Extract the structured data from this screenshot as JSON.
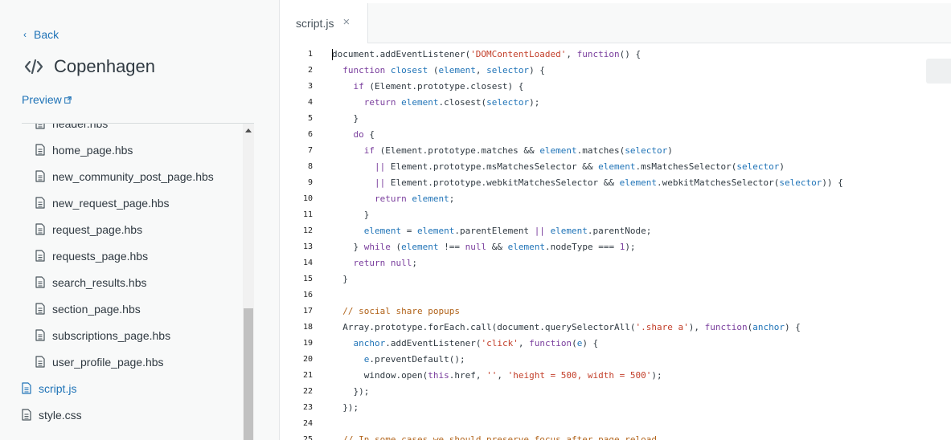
{
  "sidebar": {
    "back_label": "Back",
    "theme_name": "Copenhagen",
    "preview_label": "Preview",
    "files": [
      {
        "name": "header.hbs",
        "level": "sub",
        "active": false
      },
      {
        "name": "home_page.hbs",
        "level": "sub",
        "active": false
      },
      {
        "name": "new_community_post_page.hbs",
        "level": "sub",
        "active": false
      },
      {
        "name": "new_request_page.hbs",
        "level": "sub",
        "active": false
      },
      {
        "name": "request_page.hbs",
        "level": "sub",
        "active": false
      },
      {
        "name": "requests_page.hbs",
        "level": "sub",
        "active": false
      },
      {
        "name": "search_results.hbs",
        "level": "sub",
        "active": false
      },
      {
        "name": "section_page.hbs",
        "level": "sub",
        "active": false
      },
      {
        "name": "subscriptions_page.hbs",
        "level": "sub",
        "active": false
      },
      {
        "name": "user_profile_page.hbs",
        "level": "sub",
        "active": false
      },
      {
        "name": "script.js",
        "level": "root",
        "active": true
      },
      {
        "name": "style.css",
        "level": "root",
        "active": false
      }
    ]
  },
  "editor": {
    "tab_label": "script.js",
    "tab_close": "×",
    "lines": [
      {
        "n": "1",
        "tokens": [
          [
            "p",
            "document.addEventListener("
          ],
          [
            "s",
            "'DOMContentLoaded'"
          ],
          [
            "p",
            ", "
          ],
          [
            "k",
            "function"
          ],
          [
            "p",
            "() {"
          ]
        ]
      },
      {
        "n": "2",
        "tokens": [
          [
            "p",
            "  "
          ],
          [
            "k",
            "function"
          ],
          [
            "p",
            " "
          ],
          [
            "v",
            "closest"
          ],
          [
            "p",
            " ("
          ],
          [
            "v",
            "element"
          ],
          [
            "p",
            ", "
          ],
          [
            "v",
            "selector"
          ],
          [
            "p",
            ") {"
          ]
        ]
      },
      {
        "n": "3",
        "tokens": [
          [
            "p",
            "    "
          ],
          [
            "k",
            "if"
          ],
          [
            "p",
            " (Element.prototype.closest) {"
          ]
        ]
      },
      {
        "n": "4",
        "tokens": [
          [
            "p",
            "      "
          ],
          [
            "k",
            "return"
          ],
          [
            "p",
            " "
          ],
          [
            "v",
            "element"
          ],
          [
            "p",
            ".closest("
          ],
          [
            "v",
            "selector"
          ],
          [
            "p",
            ");"
          ]
        ]
      },
      {
        "n": "5",
        "tokens": [
          [
            "p",
            "    }"
          ]
        ]
      },
      {
        "n": "6",
        "tokens": [
          [
            "p",
            "    "
          ],
          [
            "k",
            "do"
          ],
          [
            "p",
            " {"
          ]
        ]
      },
      {
        "n": "7",
        "tokens": [
          [
            "p",
            "      "
          ],
          [
            "k",
            "if"
          ],
          [
            "p",
            " (Element.prototype.matches && "
          ],
          [
            "v",
            "element"
          ],
          [
            "p",
            ".matches("
          ],
          [
            "v",
            "selector"
          ],
          [
            "p",
            ")"
          ]
        ]
      },
      {
        "n": "8",
        "tokens": [
          [
            "p",
            "        "
          ],
          [
            "k",
            "||"
          ],
          [
            "p",
            " Element.prototype.msMatchesSelector && "
          ],
          [
            "v",
            "element"
          ],
          [
            "p",
            ".msMatchesSelector("
          ],
          [
            "v",
            "selector"
          ],
          [
            "p",
            ")"
          ]
        ]
      },
      {
        "n": "9",
        "tokens": [
          [
            "p",
            "        "
          ],
          [
            "k",
            "||"
          ],
          [
            "p",
            " Element.prototype.webkitMatchesSelector && "
          ],
          [
            "v",
            "element"
          ],
          [
            "p",
            ".webkitMatchesSelector("
          ],
          [
            "v",
            "selector"
          ],
          [
            "p",
            ")) {"
          ]
        ]
      },
      {
        "n": "10",
        "tokens": [
          [
            "p",
            "        "
          ],
          [
            "k",
            "return"
          ],
          [
            "p",
            " "
          ],
          [
            "v",
            "element"
          ],
          [
            "p",
            ";"
          ]
        ]
      },
      {
        "n": "11",
        "tokens": [
          [
            "p",
            "      }"
          ]
        ]
      },
      {
        "n": "12",
        "tokens": [
          [
            "p",
            "      "
          ],
          [
            "v",
            "element"
          ],
          [
            "p",
            " = "
          ],
          [
            "v",
            "element"
          ],
          [
            "p",
            ".parentElement "
          ],
          [
            "k",
            "||"
          ],
          [
            "p",
            " "
          ],
          [
            "v",
            "element"
          ],
          [
            "p",
            ".parentNode;"
          ]
        ]
      },
      {
        "n": "13",
        "tokens": [
          [
            "p",
            "    } "
          ],
          [
            "k",
            "while"
          ],
          [
            "p",
            " ("
          ],
          [
            "v",
            "element"
          ],
          [
            "p",
            " !== "
          ],
          [
            "k",
            "null"
          ],
          [
            "p",
            " && "
          ],
          [
            "v",
            "element"
          ],
          [
            "p",
            ".nodeType === "
          ],
          [
            "n",
            "1"
          ],
          [
            "p",
            ");"
          ]
        ]
      },
      {
        "n": "14",
        "tokens": [
          [
            "p",
            "    "
          ],
          [
            "k",
            "return"
          ],
          [
            "p",
            " "
          ],
          [
            "k",
            "null"
          ],
          [
            "p",
            ";"
          ]
        ]
      },
      {
        "n": "15",
        "tokens": [
          [
            "p",
            "  }"
          ]
        ]
      },
      {
        "n": "16",
        "tokens": []
      },
      {
        "n": "17",
        "tokens": [
          [
            "p",
            "  "
          ],
          [
            "c",
            "// social share popups"
          ]
        ]
      },
      {
        "n": "18",
        "tokens": [
          [
            "p",
            "  Array.prototype.forEach.call(document.querySelectorAll("
          ],
          [
            "s",
            "'.share a'"
          ],
          [
            "p",
            "), "
          ],
          [
            "k",
            "function"
          ],
          [
            "p",
            "("
          ],
          [
            "v",
            "anchor"
          ],
          [
            "p",
            ") {"
          ]
        ]
      },
      {
        "n": "19",
        "tokens": [
          [
            "p",
            "    "
          ],
          [
            "v",
            "anchor"
          ],
          [
            "p",
            ".addEventListener("
          ],
          [
            "s",
            "'click'"
          ],
          [
            "p",
            ", "
          ],
          [
            "k",
            "function"
          ],
          [
            "p",
            "("
          ],
          [
            "v",
            "e"
          ],
          [
            "p",
            ") {"
          ]
        ]
      },
      {
        "n": "20",
        "tokens": [
          [
            "p",
            "      "
          ],
          [
            "v",
            "e"
          ],
          [
            "p",
            ".preventDefault();"
          ]
        ]
      },
      {
        "n": "21",
        "tokens": [
          [
            "p",
            "      window.open("
          ],
          [
            "k",
            "this"
          ],
          [
            "p",
            ".href, "
          ],
          [
            "s",
            "''"
          ],
          [
            "p",
            ", "
          ],
          [
            "s",
            "'height = 500, width = 500'"
          ],
          [
            "p",
            ");"
          ]
        ]
      },
      {
        "n": "22",
        "tokens": [
          [
            "p",
            "    });"
          ]
        ]
      },
      {
        "n": "23",
        "tokens": [
          [
            "p",
            "  });"
          ]
        ]
      },
      {
        "n": "24",
        "tokens": []
      },
      {
        "n": "25",
        "tokens": [
          [
            "p",
            "  "
          ],
          [
            "c",
            "// In some cases we should preserve focus after page reload"
          ]
        ]
      }
    ]
  }
}
